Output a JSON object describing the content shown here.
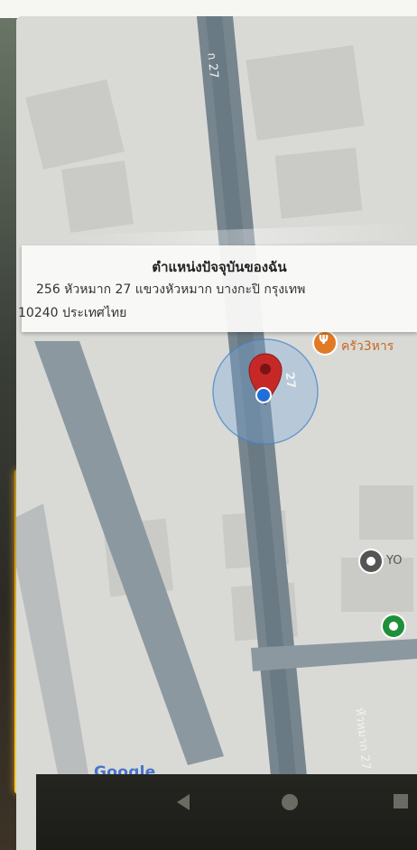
{
  "info_card": {
    "title": "ตำแหน่งปัจจุบันของฉัน",
    "address_line1": "256 หัวหมาก 27 แขวงหัวหมาก บางกะปิ กรุงเทพ",
    "address_line2": "10240 ประเทศไทย"
  },
  "map": {
    "road_label_top": "ก 27",
    "road_label_marker": "27",
    "road_label_bottom": "หัวหมาก 27",
    "poi_restaurant": "ครัว3หาร",
    "poi_you": "YO",
    "google_logo": "Google"
  },
  "colors": {
    "accent_red": "#c62828",
    "location_blue": "#1e6fd9",
    "poi_orange": "#e07a26",
    "poi_green": "#1f8f3a"
  }
}
